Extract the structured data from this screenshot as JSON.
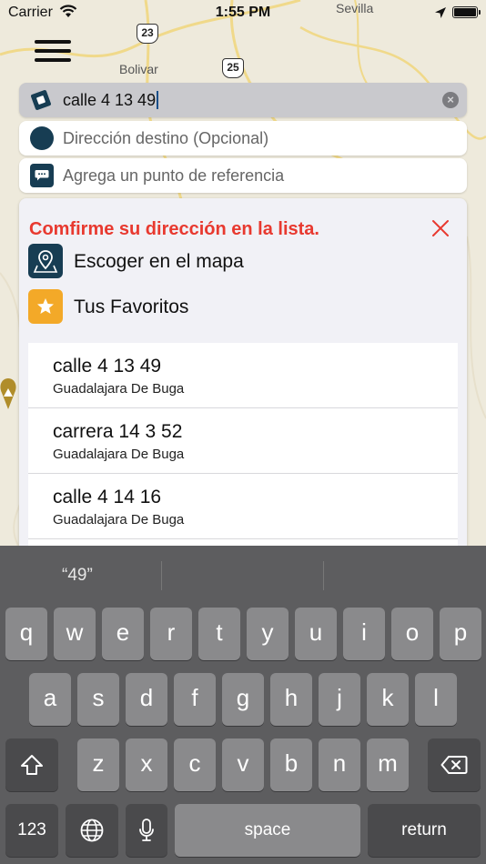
{
  "status": {
    "carrier": "Carrier",
    "time": "1:55 PM"
  },
  "map": {
    "labels": {
      "sevilla": "Sevilla",
      "bolivar": "Bolivar"
    },
    "shields": {
      "r23": "23",
      "r25": "25"
    }
  },
  "search": {
    "value": "calle 4 13 49"
  },
  "destination": {
    "placeholder": "Dirección destino (Opcional)"
  },
  "reference": {
    "placeholder": "Agrega un punto de referencia"
  },
  "panel": {
    "title": "Comfirme su dirección en la lista.",
    "map_option": "Escoger en el mapa",
    "favorites_option": "Tus Favoritos"
  },
  "results": [
    {
      "address": "calle 4 13 49",
      "city": "Guadalajara De Buga"
    },
    {
      "address": "carrera 14 3 52",
      "city": "Guadalajara De Buga"
    },
    {
      "address": "calle 4 14 16",
      "city": "Guadalajara De Buga"
    }
  ],
  "keyboard": {
    "suggestion": "“49”",
    "row1": [
      "q",
      "w",
      "e",
      "r",
      "t",
      "y",
      "u",
      "i",
      "o",
      "p"
    ],
    "row2": [
      "a",
      "s",
      "d",
      "f",
      "g",
      "h",
      "j",
      "k",
      "l"
    ],
    "row3": [
      "z",
      "x",
      "c",
      "v",
      "b",
      "n",
      "m"
    ],
    "numbers": "123",
    "space": "space",
    "return": "return"
  },
  "colors": {
    "brand_dark": "#173d53",
    "alert_red": "#e8392f",
    "favorite_orange": "#f3a928"
  }
}
